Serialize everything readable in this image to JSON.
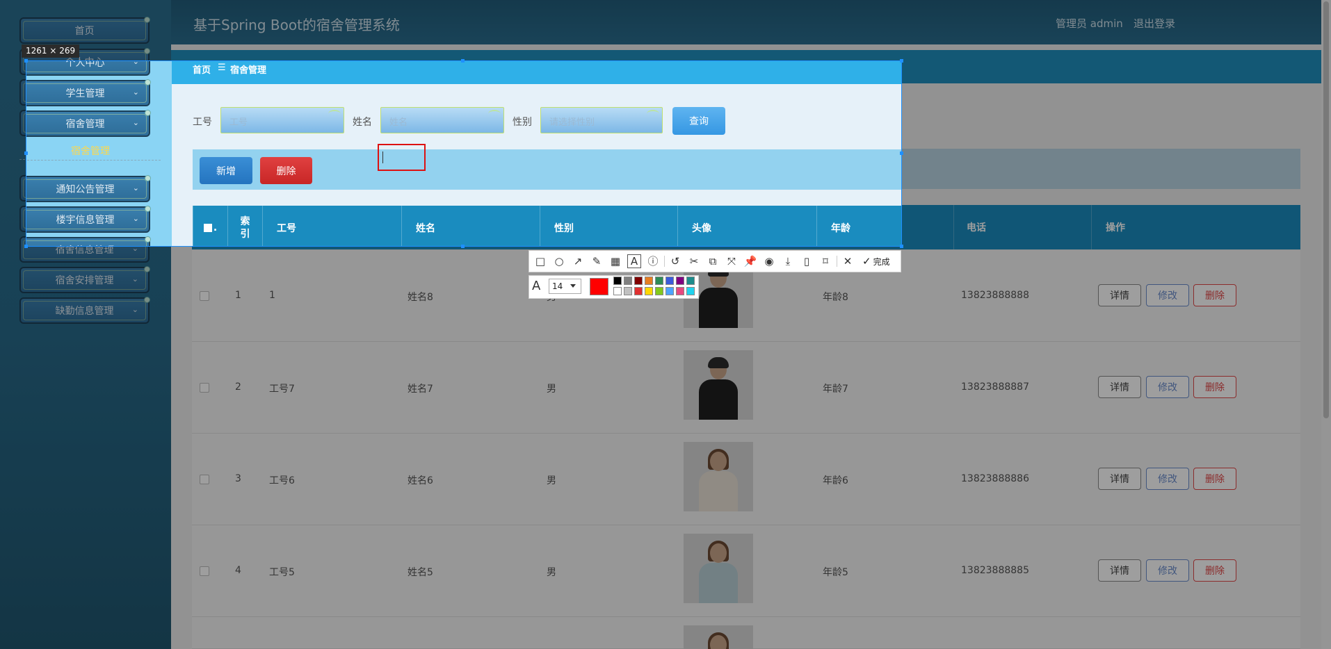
{
  "header": {
    "app_title": "基于Spring Boot的宿舍管理系统",
    "user_label": "管理员 admin",
    "logout_label": "退出登录"
  },
  "sidebar": {
    "items": [
      {
        "label": "首页"
      },
      {
        "label": "个人中心"
      },
      {
        "label": "学生管理"
      },
      {
        "label": "宿舍管理"
      },
      {
        "label": "通知公告管理"
      },
      {
        "label": "楼宇信息管理"
      },
      {
        "label": "宿舍信息管理"
      },
      {
        "label": "宿舍安排管理"
      },
      {
        "label": "缺勤信息管理"
      }
    ],
    "submenu_active": "宿舍管理"
  },
  "breadcrumb": {
    "home": "首页",
    "separator": "☰",
    "current": "宿舍管理"
  },
  "search": {
    "id_label": "工号",
    "id_placeholder": "工号",
    "name_label": "姓名",
    "name_placeholder": "姓名",
    "gender_label": "性别",
    "gender_placeholder": "请选择性别",
    "query_label": "查询"
  },
  "actions": {
    "add_label": "新增",
    "delete_label": "删除"
  },
  "table": {
    "columns": [
      "索引",
      "工号",
      "姓名",
      "性别",
      "头像",
      "年龄",
      "电话",
      "操作"
    ],
    "rows": [
      {
        "index": "1",
        "id": "1",
        "name": "姓名8",
        "gender": "男",
        "age": "年龄8",
        "phone": "13823888888"
      },
      {
        "index": "2",
        "id": "工号7",
        "name": "姓名7",
        "gender": "男",
        "age": "年龄7",
        "phone": "13823888887"
      },
      {
        "index": "3",
        "id": "工号6",
        "name": "姓名6",
        "gender": "男",
        "age": "年龄6",
        "phone": "13823888886"
      },
      {
        "index": "4",
        "id": "工号5",
        "name": "姓名5",
        "gender": "男",
        "age": "年龄5",
        "phone": "13823888885"
      }
    ],
    "op_detail": "详情",
    "op_edit": "修改",
    "op_delete": "删除"
  },
  "capture": {
    "size_label": "1261 × 269",
    "font_size": "14",
    "done_label": "完成",
    "current_color": "#ff0000",
    "palette": [
      "#000000",
      "#808080",
      "#800000",
      "#e67e22",
      "#2e8b57",
      "#3b5bdb",
      "#800080",
      "#1e8c8c",
      "#ffffff",
      "#c0c0c0",
      "#e03131",
      "#ffd700",
      "#82c91e",
      "#4da3ff",
      "#e64980",
      "#22d3ee"
    ],
    "tools": [
      "rectangle-icon",
      "ellipse-icon",
      "arrow-icon",
      "pencil-icon",
      "mosaic-icon",
      "text-icon",
      "number-icon",
      "undo-icon",
      "cutout-icon",
      "ocr-icon",
      "scroll-capture-icon",
      "pin-icon",
      "record-icon",
      "save-icon",
      "phone-icon",
      "bookmark-icon",
      "close-icon",
      "done-icon"
    ]
  }
}
